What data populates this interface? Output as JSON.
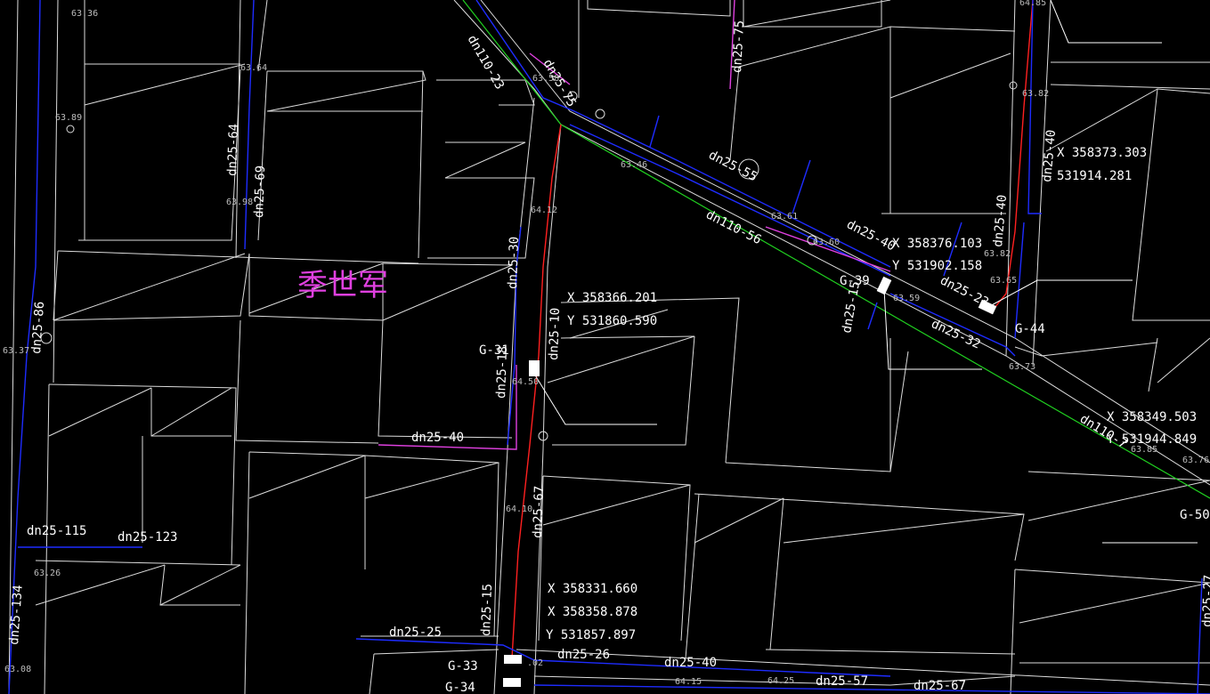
{
  "drawing": {
    "pipe_labels": [
      {
        "id": "p1",
        "text": "dn110-23"
      },
      {
        "id": "p2",
        "text": "dn25-75"
      },
      {
        "id": "p3",
        "text": "dn25-75"
      },
      {
        "id": "p4",
        "text": "dn25-64"
      },
      {
        "id": "p5",
        "text": "dn25-69"
      },
      {
        "id": "p6",
        "text": "dn25-55"
      },
      {
        "id": "p7",
        "text": "dn110-56"
      },
      {
        "id": "p8",
        "text": "dn25-40"
      },
      {
        "id": "p9",
        "text": "dn25-40"
      },
      {
        "id": "p10",
        "text": "dn25-23"
      },
      {
        "id": "p11",
        "text": "dn25-40"
      },
      {
        "id": "p12",
        "text": "dn25-30"
      },
      {
        "id": "p13",
        "text": "dn25-10"
      },
      {
        "id": "p14",
        "text": "dn25-18"
      },
      {
        "id": "p15",
        "text": "dn25-40"
      },
      {
        "id": "p16",
        "text": "dn25-15"
      },
      {
        "id": "p17",
        "text": "dn25-32"
      },
      {
        "id": "p18",
        "text": "dn25-86"
      },
      {
        "id": "p19",
        "text": "dn25-115"
      },
      {
        "id": "p20",
        "text": "dn25-123"
      },
      {
        "id": "p21",
        "text": "dn25-134"
      },
      {
        "id": "p22",
        "text": "dn25-67"
      },
      {
        "id": "p23",
        "text": "dn25-15"
      },
      {
        "id": "p24",
        "text": "dn25-25"
      },
      {
        "id": "p25",
        "text": "dn25-26"
      },
      {
        "id": "p26",
        "text": "dn25-40"
      },
      {
        "id": "p27",
        "text": "dn25-57"
      },
      {
        "id": "p28",
        "text": "dn25-67"
      },
      {
        "id": "p29",
        "text": "dn110-7"
      },
      {
        "id": "p30",
        "text": "dn25-27"
      }
    ],
    "node_labels": [
      {
        "id": "g31",
        "text": "G-31"
      },
      {
        "id": "g39",
        "text": "G-39"
      },
      {
        "id": "g44",
        "text": "G-44"
      },
      {
        "id": "g50",
        "text": "G-50"
      },
      {
        "id": "g33",
        "text": "G-33"
      },
      {
        "id": "g34",
        "text": "G-34"
      }
    ],
    "coordinates": [
      {
        "id": "c1",
        "x": "X 358373.303",
        "y": "531914.281"
      },
      {
        "id": "c2",
        "x": "X 358376.103",
        "y": "Y 531902.158"
      },
      {
        "id": "c3",
        "x": "X 358366.201",
        "y": "Y 531860.590"
      },
      {
        "id": "c4",
        "x": "X 358349.503",
        "y": "Y 531944.849"
      },
      {
        "id": "c5",
        "x": "X 358331.660",
        "y": "X 358358.878",
        "y2": "Y 531857.897"
      }
    ],
    "elevations": [
      {
        "id": "e1",
        "text": "63.36"
      },
      {
        "id": "e2",
        "text": "63.64"
      },
      {
        "id": "e3",
        "text": "63.89"
      },
      {
        "id": "e4",
        "text": "63.98"
      },
      {
        "id": "e5",
        "text": "63.58"
      },
      {
        "id": "e6",
        "text": "63.46"
      },
      {
        "id": "e7",
        "text": "63.61"
      },
      {
        "id": "e8",
        "text": "63.60"
      },
      {
        "id": "e9",
        "text": "64.12"
      },
      {
        "id": "e10",
        "text": "63.82"
      },
      {
        "id": "e11",
        "text": "63.82"
      },
      {
        "id": "e12",
        "text": "63.65"
      },
      {
        "id": "e13",
        "text": "63.59"
      },
      {
        "id": "e14",
        "text": "63.73"
      },
      {
        "id": "e15",
        "text": "63.85"
      },
      {
        "id": "e16",
        "text": "63.76"
      },
      {
        "id": "e17",
        "text": "63.37"
      },
      {
        "id": "e18",
        "text": "64.50"
      },
      {
        "id": "e19",
        "text": "64.10"
      },
      {
        "id": "e20",
        "text": "63.26"
      },
      {
        "id": "e21",
        "text": "63.08"
      },
      {
        "id": "e22",
        "text": "64.15"
      },
      {
        "id": "e23",
        "text": "64.25"
      },
      {
        "id": "e24",
        "text": ".02"
      },
      {
        "id": "e25",
        "text": "64.85"
      }
    ],
    "owner_name": "季世军"
  }
}
